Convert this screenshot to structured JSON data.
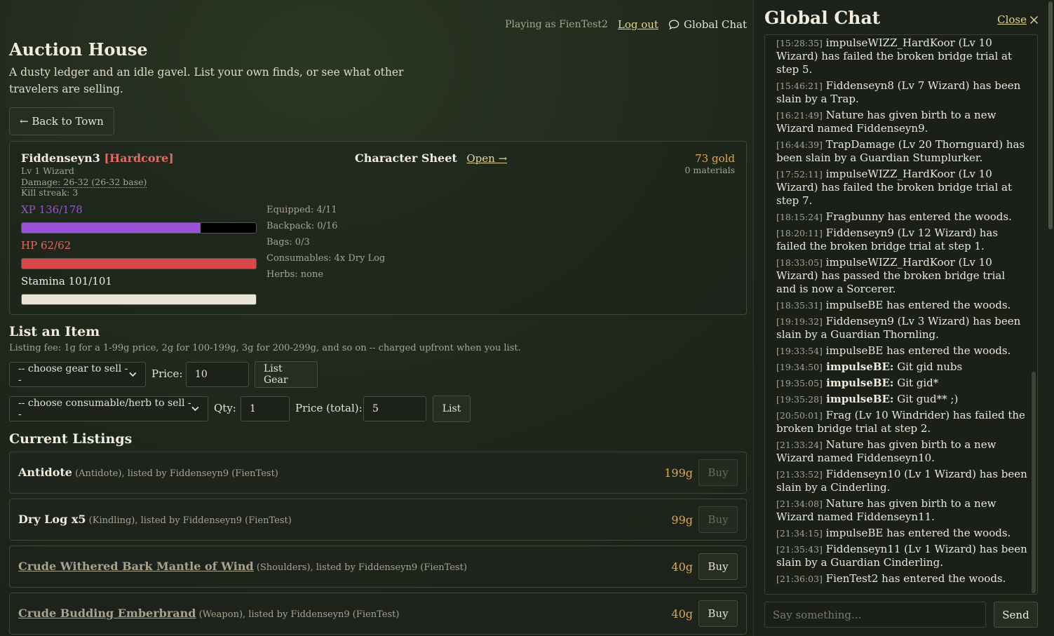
{
  "topbar": {
    "playing_as": "Playing as FienTest2",
    "logout": "Log out",
    "global_chat": "Global Chat"
  },
  "page": {
    "title": "Auction House",
    "subtitle": "A dusty ledger and an idle gavel. List your own finds, or see what other travelers are selling.",
    "back": "← Back to Town"
  },
  "character": {
    "name": "Fiddenseyn3",
    "tag": "[Hardcore]",
    "level": "Lv 1 Wizard",
    "damage": "Damage: 26-32 (26-32 base)",
    "kill_streak": "Kill streak: 3",
    "sheet_label": "Character Sheet",
    "sheet_open": "Open →",
    "gold": "73 gold",
    "materials": "0 materials",
    "xp_label": "XP 136/178",
    "xp_fraction": 0.764,
    "hp_label": "HP 62/62",
    "hp_fraction": 1.0,
    "stamina_label": "Stamina 101/101",
    "stamina_fraction": 1.0,
    "equipped": "Equipped: 4/11",
    "backpack": "Backpack: 0/16",
    "bags": "Bags: 0/3",
    "consumables": "Consumables: 4x Dry Log",
    "herbs": "Herbs: none"
  },
  "list_item": {
    "heading": "List an Item",
    "fee": "Listing fee: 1g for a 1-99g price, 2g for 100-199g, 3g for 200-299g, and so on -- charged upfront when you list.",
    "gear_select": "-- choose gear to sell --",
    "price_label": "Price:",
    "price_value": "10",
    "list_gear": "List Gear",
    "consumable_select": "-- choose consumable/herb to sell --",
    "qty_label": "Qty:",
    "qty_value": "1",
    "total_label": "Price (total):",
    "total_value": "5",
    "list": "List"
  },
  "listings": {
    "heading": "Current Listings",
    "items": [
      {
        "name": "Antidote",
        "detail": " (Antidote), listed by Fiddenseyn9 (FienTest)",
        "price": "199g",
        "buy": "Buy"
      },
      {
        "name": "Dry Log x5",
        "detail": " (Kindling), listed by Fiddenseyn9 (FienTest)",
        "price": "99g",
        "buy": "Buy"
      },
      {
        "name": "Crude Withered Bark Mantle of Wind",
        "detail": " (Shoulders), listed by Fiddenseyn9 (FienTest)",
        "price": "40g",
        "buy": "Buy"
      },
      {
        "name": "Crude Budding Emberbrand",
        "detail": " (Weapon), listed by Fiddenseyn9 (FienTest)",
        "price": "40g",
        "buy": "Buy"
      }
    ]
  },
  "chat": {
    "title": "Global Chat",
    "close": "Close",
    "input_placeholder": "Say something...",
    "send": "Send",
    "messages": [
      {
        "ts": "[15:28:35]",
        "who": "",
        "text": " impulseWIZZ_HardKoor (Lv 10 Wizard) has failed the broken bridge trial at step 5."
      },
      {
        "ts": "[15:46:21]",
        "who": "",
        "text": " Fiddenseyn8 (Lv 7 Wizard) has been slain by a Trap."
      },
      {
        "ts": "[16:21:49]",
        "who": "",
        "text": " Nature has given birth to a new Wizard named Fiddenseyn9."
      },
      {
        "ts": "[16:44:39]",
        "who": "",
        "text": " TrapDamage (Lv 20 Thornguard) has been slain by a Guardian Stumplurker."
      },
      {
        "ts": "[17:52:11]",
        "who": "",
        "text": " impulseWIZZ_HardKoor (Lv 10 Wizard) has failed the broken bridge trial at step 7."
      },
      {
        "ts": "[18:15:24]",
        "who": "",
        "text": " Fragbunny has entered the woods."
      },
      {
        "ts": "[18:20:11]",
        "who": "",
        "text": " Fiddenseyn9 (Lv 12 Wizard) has failed the broken bridge trial at step 1."
      },
      {
        "ts": "[18:33:05]",
        "who": "",
        "text": " impulseWIZZ_HardKoor (Lv 10 Wizard) has passed the broken bridge trial and is now a Sorcerer."
      },
      {
        "ts": "[18:35:31]",
        "who": "",
        "text": " impulseBE has entered the woods."
      },
      {
        "ts": "[19:19:32]",
        "who": "",
        "text": " Fiddenseyn9 (Lv 3 Wizard) has been slain by a Guardian Thornling."
      },
      {
        "ts": "[19:33:54]",
        "who": "",
        "text": " impulseBE has entered the woods."
      },
      {
        "ts": "[19:34:50]",
        "who": " impulseBE:",
        "text": " Git gid nubs"
      },
      {
        "ts": "[19:35:05]",
        "who": " impulseBE:",
        "text": " Git gid*"
      },
      {
        "ts": "[19:35:28]",
        "who": " impulseBE:",
        "text": " Git gud** ;)"
      },
      {
        "ts": "[20:50:01]",
        "who": "",
        "text": " Frag (Lv 10 Windrider) has failed the broken bridge trial at step 2."
      },
      {
        "ts": "[21:33:24]",
        "who": "",
        "text": " Nature has given birth to a new Wizard named Fiddenseyn10."
      },
      {
        "ts": "[21:33:52]",
        "who": "",
        "text": " Fiddenseyn10 (Lv 1 Wizard) has been slain by a Cinderling."
      },
      {
        "ts": "[21:34:08]",
        "who": "",
        "text": " Nature has given birth to a new Wizard named Fiddenseyn11."
      },
      {
        "ts": "[21:34:15]",
        "who": "",
        "text": " impulseBE has entered the woods."
      },
      {
        "ts": "[21:35:43]",
        "who": "",
        "text": " Fiddenseyn11 (Lv 1 Wizard) has been slain by a Guardian Cinderling."
      },
      {
        "ts": "[21:36:03]",
        "who": "",
        "text": " FienTest2 has entered the woods."
      }
    ]
  },
  "colors": {
    "xp": "#9b52d9",
    "hp": "#d9474a",
    "stamina": "#e9e5d7",
    "gold": "#e1a84b",
    "link": "#e2d78e",
    "hardcore": "#e06a5f"
  }
}
